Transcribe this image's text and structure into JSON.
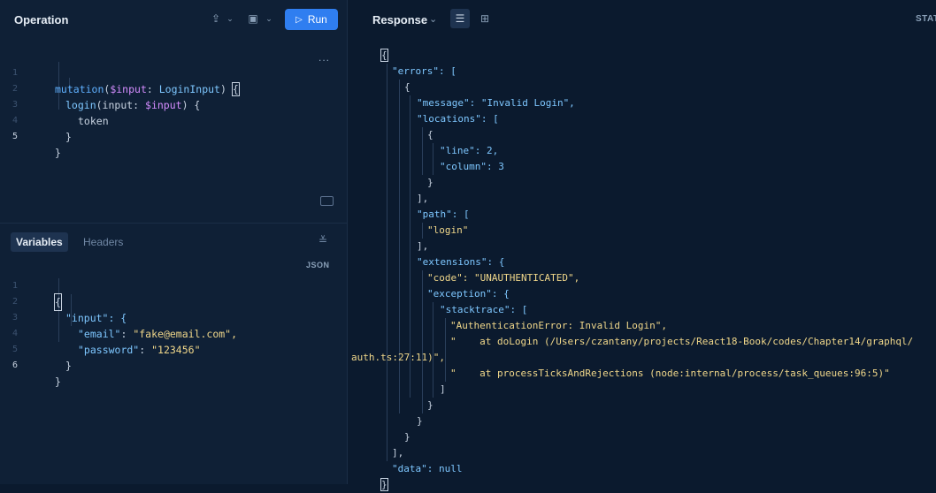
{
  "operation": {
    "title": "Operation",
    "run_label": "Run",
    "lines": [
      {
        "n": "1",
        "text": "mutation($input: LoginInput) {"
      },
      {
        "n": "2",
        "text": "login(input: $input) {"
      },
      {
        "n": "3",
        "text": "token"
      },
      {
        "n": "4",
        "text": "}"
      },
      {
        "n": "5",
        "text": "}"
      }
    ],
    "more": "..."
  },
  "variables": {
    "tab_active": "Variables",
    "tab_inactive": "Headers",
    "format": "JSON",
    "lines": [
      {
        "n": "1",
        "text": "{"
      },
      {
        "n": "2",
        "text": "\"input\": {"
      },
      {
        "n": "3",
        "key": "\"email\"",
        "val": "\"fake@email.com\","
      },
      {
        "n": "4",
        "key": "\"password\"",
        "val": "\"123456\""
      },
      {
        "n": "5",
        "text": "}"
      },
      {
        "n": "6",
        "text": "}"
      }
    ]
  },
  "response": {
    "title": "Response",
    "status": "STAT",
    "lines": [
      "{",
      "\"errors\": [",
      "{",
      "\"message\": \"Invalid Login\",",
      "\"locations\": [",
      "{",
      "\"line\": 2,",
      "\"column\": 3",
      "}",
      "],",
      "\"path\": [",
      "\"login\"",
      "],",
      "\"extensions\": {",
      "\"code\": \"UNAUTHENTICATED\",",
      "\"exception\": {",
      "\"stacktrace\": [",
      "\"AuthenticationError: Invalid Login\",",
      "\"    at doLogin (/Users/czantany/projects/React18-Book/codes/Chapter14/graphql/",
      "auth.ts:27:11)\",",
      "\"    at processTicksAndRejections (node:internal/process/task_queues:96:5)\"",
      "]",
      "}",
      "}",
      "}",
      "],",
      "\"data\": null",
      "}"
    ]
  },
  "colors": {
    "accent": "#2f7ef0",
    "background": "#0b1a2e",
    "panel": "#0f2036"
  }
}
